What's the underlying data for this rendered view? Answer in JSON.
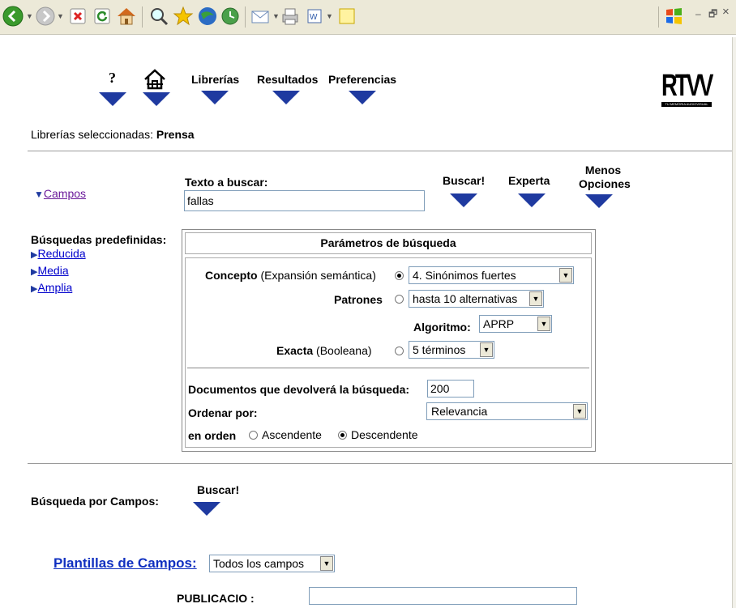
{
  "window": {
    "minimize": "–",
    "restore": "🗗",
    "close": "×"
  },
  "nav": {
    "help": "?",
    "libraries": "Librerías",
    "results": "Resultados",
    "preferences": "Preferencias"
  },
  "logo": {
    "text": "RTVV",
    "subtext": "TU MEMÒRIA AUDIOVISUAL"
  },
  "selected": {
    "label": "Librerías seleccionadas:",
    "value": "Prensa"
  },
  "search": {
    "campos_link": "Campos",
    "text_label": "Texto a buscar:",
    "text_value": "fallas",
    "buscar": "Buscar!",
    "experta": "Experta",
    "menos": "Menos",
    "opciones": "Opciones"
  },
  "predefined": {
    "title": "Búsquedas predefinidas:",
    "items": [
      "Reducida",
      "Media",
      "Amplia"
    ]
  },
  "params": {
    "title": "Parámetros de búsqueda",
    "concepto_label": "Concepto",
    "concepto_sub": "(Expansión semántica)",
    "concepto_value": "4. Sinónimos fuertes",
    "patrones_label": "Patrones",
    "patrones_value": "hasta 10 alternativas",
    "algoritmo_label": "Algoritmo:",
    "algoritmo_value": "APRP",
    "exacta_label": "Exacta",
    "exacta_sub": "(Booleana)",
    "exacta_value": "5 términos",
    "docs_label": "Documentos que devolverá la búsqueda:",
    "docs_value": "200",
    "order_label": "Ordenar por:",
    "order_value": "Relevancia",
    "direction_label": "en orden",
    "asc": "Ascendente",
    "desc": "Descendente"
  },
  "fields": {
    "title": "Búsqueda por Campos:",
    "buscar": "Buscar!",
    "templates_label": "Plantillas de Campos:",
    "templates_value": "Todos los campos",
    "publicacio_label": "PUBLICACIO :",
    "publicacio_value": ""
  }
}
